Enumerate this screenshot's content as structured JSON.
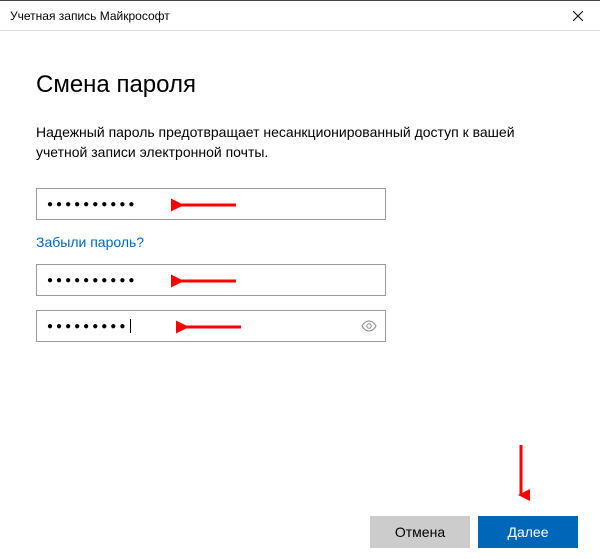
{
  "window": {
    "title": "Учетная запись Майкрософт"
  },
  "page": {
    "heading": "Смена пароля",
    "description": "Надежный пароль предотвращает несанкционированный доступ к вашей учетной записи электронной почты."
  },
  "fields": {
    "current_password_mask": "●●●●●●●●●●",
    "new_password_mask": "●●●●●●●●●●",
    "confirm_password_mask": "●●●●●●●●●"
  },
  "links": {
    "forgot": "Забыли пароль?"
  },
  "buttons": {
    "cancel": "Отмена",
    "next": "Далее"
  },
  "colors": {
    "accent": "#0067b8",
    "arrow": "#ff0000"
  }
}
